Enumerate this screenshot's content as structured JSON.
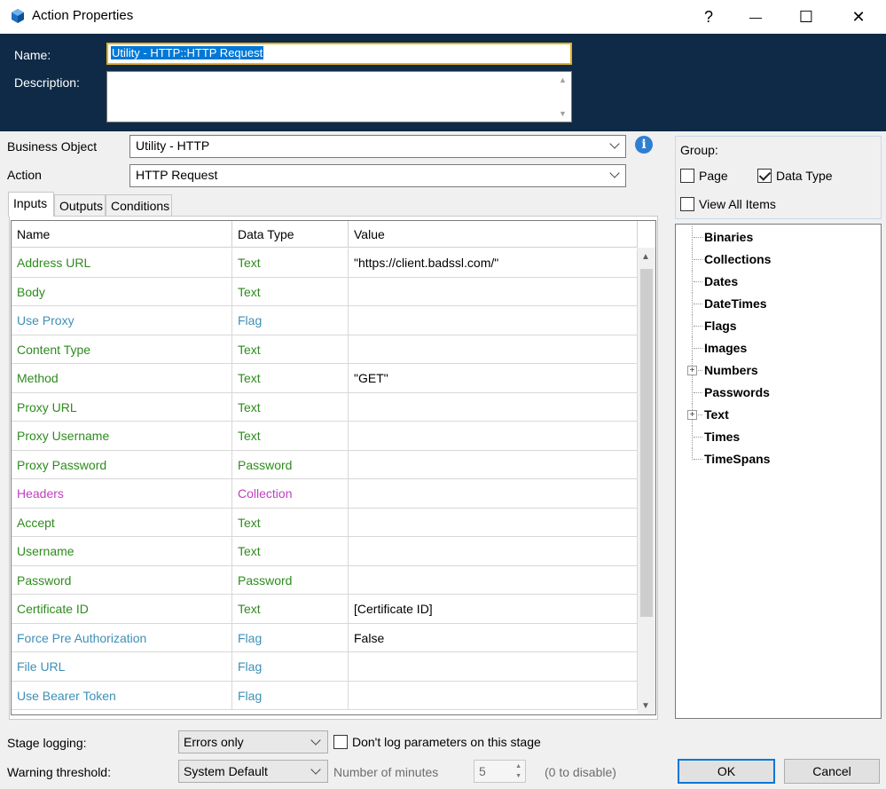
{
  "window": {
    "title": "Action Properties",
    "help_glyph": "?",
    "minimize_glyph": "—",
    "maximize_glyph": "☐",
    "close_glyph": "✕"
  },
  "header": {
    "name_label": "Name:",
    "name_value": "Utility - HTTP::HTTP Request",
    "description_label": "Description:",
    "description_value": ""
  },
  "form": {
    "business_object_label": "Business Object",
    "business_object_value": "Utility - HTTP",
    "action_label": "Action",
    "action_value": "HTTP Request",
    "info_glyph": "i"
  },
  "tabs": [
    {
      "label": "Inputs",
      "active": true
    },
    {
      "label": "Outputs",
      "active": false
    },
    {
      "label": "Conditions",
      "active": false
    }
  ],
  "grid": {
    "columns": [
      "Name",
      "Data Type",
      "Value"
    ],
    "rows": [
      {
        "name": "Address URL",
        "type": "Text",
        "value": "\"https://client.badssl.com/\""
      },
      {
        "name": "Body",
        "type": "Text",
        "value": ""
      },
      {
        "name": "Use Proxy",
        "type": "Flag",
        "value": ""
      },
      {
        "name": "Content Type",
        "type": "Text",
        "value": ""
      },
      {
        "name": "Method",
        "type": "Text",
        "value": "\"GET\""
      },
      {
        "name": "Proxy URL",
        "type": "Text",
        "value": ""
      },
      {
        "name": "Proxy Username",
        "type": "Text",
        "value": ""
      },
      {
        "name": "Proxy Password",
        "type": "Password",
        "value": ""
      },
      {
        "name": "Headers",
        "type": "Collection",
        "value": ""
      },
      {
        "name": "Accept",
        "type": "Text",
        "value": ""
      },
      {
        "name": "Username",
        "type": "Text",
        "value": ""
      },
      {
        "name": "Password",
        "type": "Password",
        "value": ""
      },
      {
        "name": "Certificate ID",
        "type": "Text",
        "value": "[Certificate ID]"
      },
      {
        "name": "Force Pre Authorization",
        "type": "Flag",
        "value": "False"
      },
      {
        "name": "File URL",
        "type": "Flag",
        "value": ""
      },
      {
        "name": "Use Bearer Token",
        "type": "Flag",
        "value": ""
      }
    ],
    "type_colors": {
      "Text": "#2e8b1e",
      "Password": "#2e8b1e",
      "Flag": "#3f8fb6",
      "Collection": "#c040c0"
    }
  },
  "group": {
    "label": "Group:",
    "page_label": "Page",
    "page_checked": false,
    "data_type_label": "Data Type",
    "data_type_checked": true,
    "view_all_label": "View All Items",
    "view_all_checked": false
  },
  "tree": {
    "items": [
      {
        "label": "Binaries",
        "expandable": false
      },
      {
        "label": "Collections",
        "expandable": false
      },
      {
        "label": "Dates",
        "expandable": false
      },
      {
        "label": "DateTimes",
        "expandable": false
      },
      {
        "label": "Flags",
        "expandable": false
      },
      {
        "label": "Images",
        "expandable": false
      },
      {
        "label": "Numbers",
        "expandable": true
      },
      {
        "label": "Passwords",
        "expandable": false
      },
      {
        "label": "Text",
        "expandable": true
      },
      {
        "label": "Times",
        "expandable": false
      },
      {
        "label": "TimeSpans",
        "expandable": false
      }
    ]
  },
  "footer": {
    "stage_logging_label": "Stage logging:",
    "stage_logging_value": "Errors only",
    "dont_log_label": "Don't log parameters on this stage",
    "dont_log_checked": false,
    "warning_label": "Warning threshold:",
    "warning_value": "System Default",
    "minutes_label": "Number of minutes",
    "minutes_value": "5",
    "disable_hint": "(0 to disable)",
    "ok_label": "OK",
    "cancel_label": "Cancel"
  }
}
